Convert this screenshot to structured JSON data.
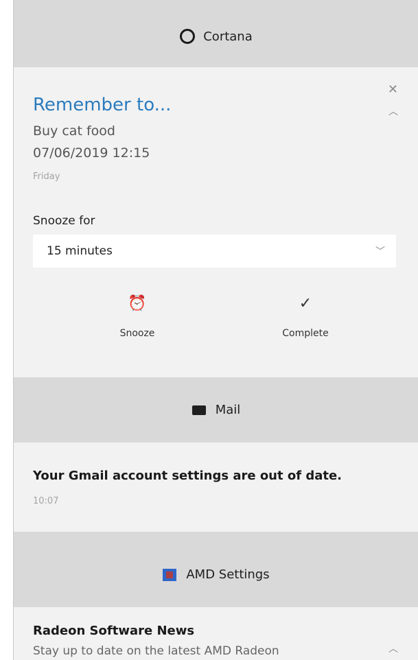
{
  "cortana": {
    "header_label": "Cortana",
    "reminder_title": "Remember to...",
    "reminder_text": "Buy cat food",
    "reminder_datetime": "07/06/2019 12:15",
    "reminder_day": "Friday",
    "snooze_label": "Snooze for",
    "snooze_value": "15 minutes",
    "snooze_button_label": "Snooze",
    "complete_button_label": "Complete",
    "close_glyph": "✕",
    "collapse_glyph": "︿",
    "chevron_glyph": "﹀",
    "alarm_glyph": "⏰",
    "check_glyph": "✓"
  },
  "mail": {
    "header_label": "Mail",
    "message": "Your Gmail account settings are out of date.",
    "time": "10:07"
  },
  "amd": {
    "header_label": "AMD Settings",
    "title": "Radeon Software News",
    "description": "Stay up to date on the latest AMD Radeon",
    "collapse_glyph": "︿"
  },
  "colors": {
    "accent": "#2b7bbd",
    "panel_bg": "#d9d9d9",
    "card_bg": "#f2f2f2"
  }
}
